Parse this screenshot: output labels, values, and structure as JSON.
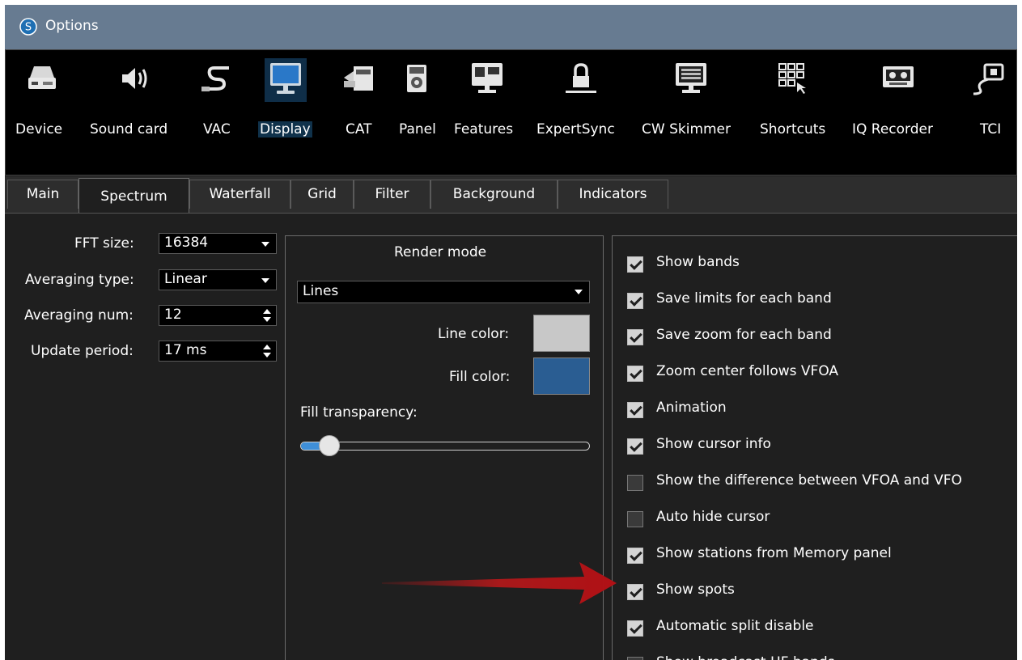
{
  "window": {
    "title": "Options"
  },
  "toolbar": {
    "items": [
      {
        "label": "Device",
        "icon": "device-icon"
      },
      {
        "label": "Sound card",
        "icon": "speaker-icon"
      },
      {
        "label": "VAC",
        "icon": "cable-icon"
      },
      {
        "label": "Display",
        "icon": "monitor-icon",
        "selected": true
      },
      {
        "label": "CAT",
        "icon": "cat-icon"
      },
      {
        "label": "Panel",
        "icon": "panel-icon"
      },
      {
        "label": "Features",
        "icon": "features-icon"
      },
      {
        "label": "ExpertSync",
        "icon": "lock-icon"
      },
      {
        "label": "CW Skimmer",
        "icon": "keyboard-monitor-icon"
      },
      {
        "label": "Shortcuts",
        "icon": "keypad-icon"
      },
      {
        "label": "IQ Recorder",
        "icon": "tape-icon"
      },
      {
        "label": "TCI",
        "icon": "tci-icon"
      }
    ]
  },
  "tabs": [
    "Main",
    "Spectrum",
    "Waterfall",
    "Grid",
    "Filter",
    "Background",
    "Indicators"
  ],
  "active_tab": "Spectrum",
  "left": {
    "fft_label": "FFT size:",
    "fft_value": "16384",
    "avg_type_label": "Averaging type:",
    "avg_type_value": "Linear",
    "avg_num_label": "Averaging num:",
    "avg_num_value": "12",
    "update_label": "Update period:",
    "update_value": "17 ms"
  },
  "render": {
    "title": "Render mode",
    "mode_value": "Lines",
    "line_color_label": "Line color:",
    "fill_color_label": "Fill color:",
    "line_color": "#c8c8c8",
    "fill_color": "#2a5d92",
    "transparency_label": "Fill transparency:",
    "transparency_fraction": 0.1
  },
  "options": [
    {
      "label": "Show bands",
      "checked": true
    },
    {
      "label": "Save limits for each band",
      "checked": true
    },
    {
      "label": "Save zoom for each band",
      "checked": true
    },
    {
      "label": "Zoom center follows VFOA",
      "checked": true
    },
    {
      "label": "Animation",
      "checked": true
    },
    {
      "label": "Show cursor info",
      "checked": true
    },
    {
      "label": "Show the difference between VFOA and VFO",
      "checked": false
    },
    {
      "label": "Auto hide cursor",
      "checked": false
    },
    {
      "label": "Show stations from Memory panel",
      "checked": true
    },
    {
      "label": "Show spots",
      "checked": true
    },
    {
      "label": "Automatic split disable",
      "checked": true
    },
    {
      "label": "Show broadcast HF bands",
      "checked": false
    }
  ],
  "colors": {
    "titlebar": "#677b91",
    "annotation_arrow": "#c0181a",
    "accent": "#3f8fd8"
  }
}
